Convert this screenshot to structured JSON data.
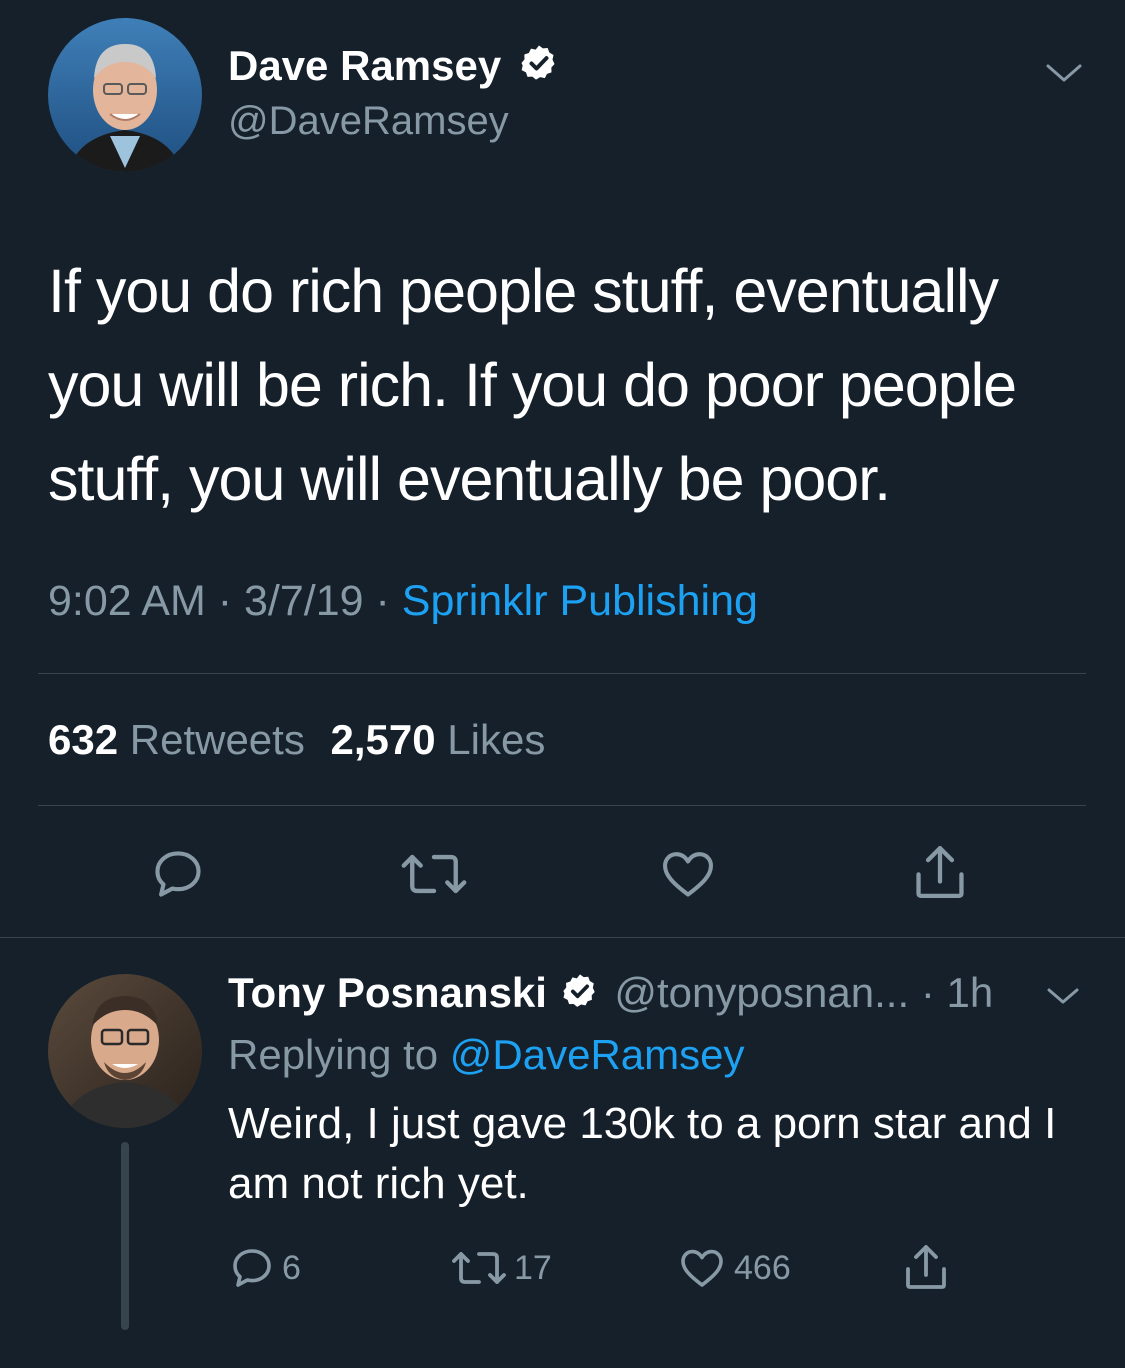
{
  "tweet": {
    "author_name": "Dave Ramsey",
    "author_handle": "@DaveRamsey",
    "text": "If you do rich people stuff, eventually you will be rich. If you do poor people stuff, you will eventually be poor.",
    "time": "9:02 AM",
    "sep1": "·",
    "date": "3/7/19",
    "sep2": "·",
    "source": "Sprinklr Publishing",
    "retweets_count": "632",
    "retweets_label": "Retweets",
    "likes_count": "2,570",
    "likes_label": "Likes"
  },
  "reply": {
    "author_name": "Tony Posnanski",
    "author_handle": "@tonyposnan...",
    "time_ago": "· 1h",
    "replying_prefix": "Replying to",
    "replying_to": "@DaveRamsey",
    "text": "Weird, I just gave 130k to a porn star and I am not rich yet.",
    "reply_count": "6",
    "retweet_count": "17",
    "like_count": "466"
  },
  "icons": {
    "expand": "chevron-down-icon",
    "verified": "verified-badge-icon",
    "reply": "reply-icon",
    "retweet": "retweet-icon",
    "like": "heart-icon",
    "share": "share-icon"
  },
  "colors": {
    "background": "#15202b",
    "link": "#1da1f2",
    "muted": "#8899a6",
    "divider": "#38444d"
  }
}
